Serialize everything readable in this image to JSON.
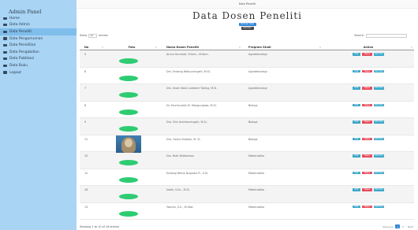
{
  "sidebar": {
    "title": "Admin Panel",
    "items": [
      {
        "label": "Home",
        "active": false
      },
      {
        "label": "Data Admin",
        "active": false
      },
      {
        "label": "Data Peneliti",
        "active": true
      },
      {
        "label": "Data Pengumuman",
        "active": false
      },
      {
        "label": "Data Penelitian",
        "active": false
      },
      {
        "label": "Data Pengabdian",
        "active": false
      },
      {
        "label": "Data Publikasi",
        "active": false
      },
      {
        "label": "Data Buku",
        "active": false
      },
      {
        "label": "Logout",
        "active": false
      }
    ]
  },
  "topbar": {
    "title": "Data Peneliti"
  },
  "main": {
    "title": "Data Dosen Peneliti",
    "add_button": "Tambah Data",
    "back_button": "Kembali"
  },
  "controls": {
    "show_label": "Show",
    "entries_value": "10",
    "entries_label": "entries",
    "search_label": "Search:"
  },
  "table": {
    "headers": {
      "no": "No",
      "foto": "Foto",
      "nama": "Nama Dosen Peneliti",
      "prodi": "Program Studi",
      "aksi": "Action"
    },
    "action_labels": {
      "edit": "Edit",
      "hapus": "Hapus",
      "edit_foto": "Edit Foto"
    },
    "rows": [
      {
        "no": "5",
        "nama": "Annur Kurniadi, S.Kom., M.Kom.",
        "prodi": "Agroteknologi",
        "photo": "placeholder"
      },
      {
        "no": "6",
        "nama": "Drs. Endang Wahyuningsih, M.Si.",
        "prodi": "Agroteknologi",
        "photo": "placeholder"
      },
      {
        "no": "7",
        "nama": "Drs. Imam Basil Lambert Tobing, M.Si.",
        "prodi": "Agroteknologi",
        "photo": "placeholder"
      },
      {
        "no": "8",
        "nama": "Dr. Farchruddin M. Mangunjawa, M.Si.",
        "prodi": "Biologi",
        "photo": "placeholder"
      },
      {
        "no": "9",
        "nama": "Dra. Dini Andrianningsih, M.Si.",
        "prodi": "Biologi",
        "photo": "placeholder"
      },
      {
        "no": "11",
        "nama": "Dra. Harini Budiani, M. Si.",
        "prodi": "Biologi",
        "photo": "image"
      },
      {
        "no": "10",
        "nama": "Drs. Riah Widiasman",
        "prodi": "Matematika",
        "photo": "placeholder"
      },
      {
        "no": "12",
        "nama": "Endang Retno Nugroho R., S.Si.",
        "prodi": "Matematika",
        "photo": "placeholder"
      },
      {
        "no": "16",
        "nama": "Iwahi, S.Kc., M.Si.",
        "prodi": "Matematika",
        "photo": "placeholder"
      },
      {
        "no": "13",
        "nama": "Yasmin, S.E., M.Stat.",
        "prodi": "Matematika",
        "photo": "placeholder"
      }
    ]
  },
  "footer": {
    "info": "Showing 1 to 10 of 16 entries",
    "pagination": {
      "previous": "Previous",
      "pages": [
        "1",
        "2"
      ],
      "current": "1",
      "next": "Next"
    }
  }
}
